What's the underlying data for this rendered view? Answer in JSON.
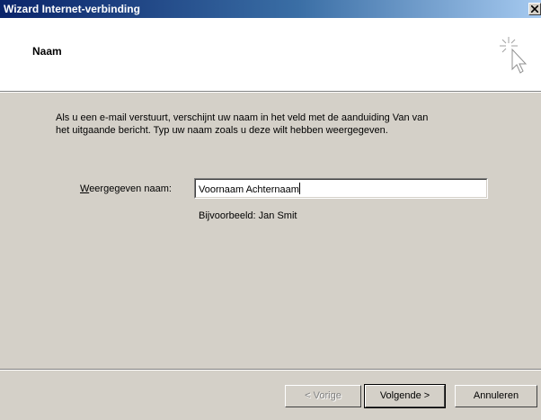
{
  "window": {
    "title": "Wizard Internet-verbinding",
    "close_icon": "close-icon"
  },
  "header": {
    "title": "Naam",
    "icon": "wizard-cursor-sparkle-icon"
  },
  "intro": {
    "line1": "Als u een e-mail verstuurt, verschijnt uw naam in het veld met de aanduiding Van van",
    "line2": "het uitgaande bericht. Typ uw naam zoals u deze wilt hebben weergegeven."
  },
  "form": {
    "label_access_key": "W",
    "label_rest": "eergegeven naam:",
    "value": "Voornaam Achternaam",
    "example": "Bijvoorbeeld: Jan Smit"
  },
  "buttons": {
    "back": "< Vorige",
    "next": "Volgende >",
    "cancel": "Annuleren"
  }
}
